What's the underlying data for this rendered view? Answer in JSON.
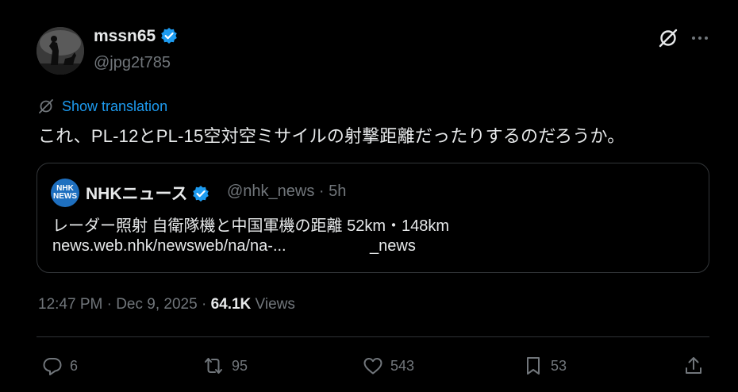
{
  "author": {
    "display_name": "mssn65",
    "handle": "@jpg2t785"
  },
  "translate": {
    "label": "Show translation"
  },
  "tweet": {
    "text": "これ、PL-12とPL-15空対空ミサイルの射撃距離だったりするのだろうか。"
  },
  "quote": {
    "avatar_text": "NHK NEWS",
    "name": "NHKニュース",
    "handle_time": "@nhk_news · 5h",
    "text": "レーダー照射 自衛隊機と中国軍機の距離 52km・148km",
    "link": "news.web.nhk/newsweb/na/na-...",
    "link_tail": "_news"
  },
  "meta": {
    "time_date": "12:47 PM · Dec 9, 2025 · ",
    "views_count": "64.1K",
    "views_label": " Views"
  },
  "actions": {
    "replies": "6",
    "reposts": "95",
    "likes": "543",
    "bookmarks": "53"
  },
  "icons": [
    "verified-icon",
    "grok-icon",
    "more-icon",
    "translate-icon",
    "reply-icon",
    "repost-icon",
    "like-icon",
    "bookmark-icon",
    "share-icon"
  ],
  "colors": {
    "accent": "#1d9bf0",
    "muted": "#71767b",
    "text": "#e7e9ea",
    "background": "#000000"
  }
}
